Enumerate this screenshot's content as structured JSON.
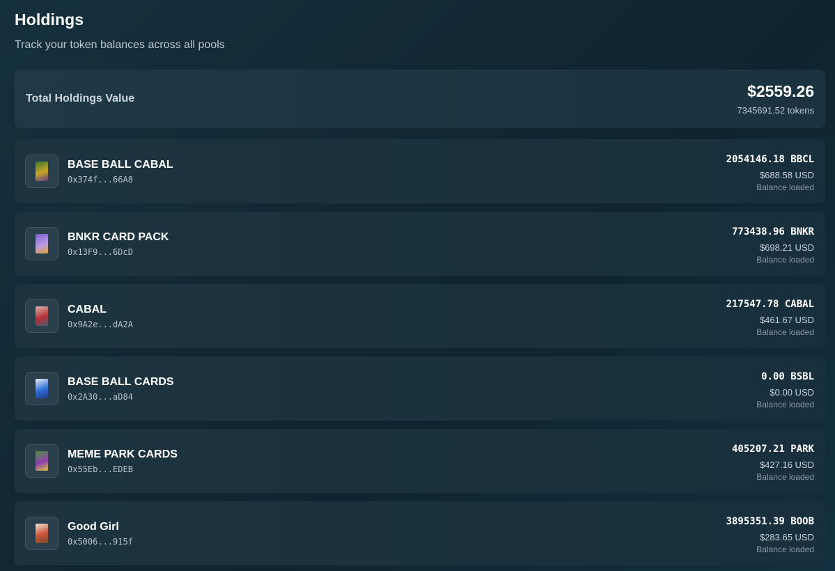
{
  "header": {
    "title": "Holdings",
    "subtitle": "Track your token balances across all pools"
  },
  "summary": {
    "label": "Total Holdings Value",
    "value": "$2559.26",
    "tokens": "7345691.52 tokens"
  },
  "holdings": [
    {
      "name": "BASE BALL CABAL",
      "address": "0x374f...66A8",
      "balance": "2054146.18 BBCL",
      "usd": "$688.58 USD",
      "status": "Balance loaded",
      "thumb_colors": [
        "#3f7a2e",
        "#c9a52a",
        "#5d3a80"
      ]
    },
    {
      "name": "BNKR CARD PACK",
      "address": "0x13F9...6DcD",
      "balance": "773438.96 BNKR",
      "usd": "$698.21 USD",
      "status": "Balance loaded",
      "thumb_colors": [
        "#7b62c9",
        "#b99ae8",
        "#e0a23a"
      ]
    },
    {
      "name": "CABAL",
      "address": "0x9A2e...dA2A",
      "balance": "217547.78 CABAL",
      "usd": "$461.67 USD",
      "status": "Balance loaded",
      "thumb_colors": [
        "#d9b6b0",
        "#b8303a",
        "#4a5a6a"
      ]
    },
    {
      "name": "BASE BALL CARDS",
      "address": "0x2A30...aD84",
      "balance": "0.00 BSBL",
      "usd": "$0.00 USD",
      "status": "Balance loaded",
      "thumb_colors": [
        "#e8eef5",
        "#2f6fd6",
        "#1e3a8a"
      ]
    },
    {
      "name": "MEME PARK CARDS",
      "address": "0x55Eb...EDEB",
      "balance": "405207.21 PARK",
      "usd": "$427.16 USD",
      "status": "Balance loaded",
      "thumb_colors": [
        "#4f8f3a",
        "#8d3fb0",
        "#d5c23a"
      ]
    },
    {
      "name": "Good Girl",
      "address": "0x5006...915f",
      "balance": "3895351.39 BOOB",
      "usd": "$283.65 USD",
      "status": "Balance loaded",
      "thumb_colors": [
        "#f1e2cf",
        "#c7523a",
        "#7a4a30"
      ]
    }
  ]
}
